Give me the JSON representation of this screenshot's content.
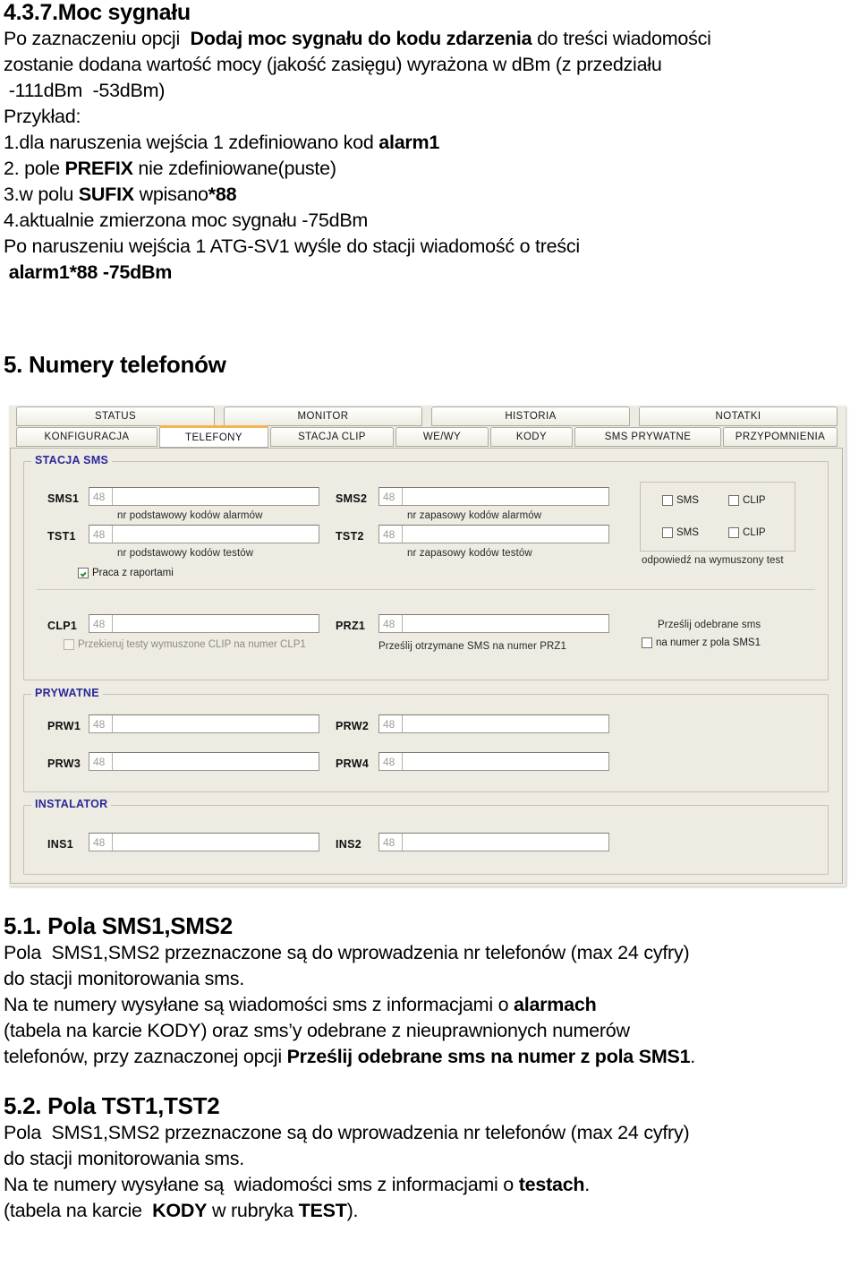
{
  "doc": {
    "section_4_3_7": {
      "heading": "4.3.7.Moc sygnału",
      "line1_a": "Po zaznaczeniu opcji  ",
      "line1_b": "Dodaj moc sygnału do kodu zdarzenia",
      "line1_c": " do treści wiadomości",
      "line2": "zostanie dodana wartość mocy (jakość zasięgu) wyrażona w dBm (z przedziału",
      "line3": " -111dBm  -53dBm)",
      "line4": "Przykład:",
      "line5_a": "1.dla naruszenia wejścia 1 zdefiniowano kod ",
      "line5_b": "alarm1",
      "line6_a": "2. pole ",
      "line6_b": "PREFIX",
      "line6_c": " nie zdefiniowane(puste)",
      "line7_a": "3.w polu ",
      "line7_b": "SUFIX",
      "line7_c": " wpisano",
      "line7_d": "*88",
      "line8": "4.aktualnie zmierzona moc sygnału -75dBm",
      "line9": "Po naruszeniu wejścia 1 ATG-SV1 wyśle do stacji wiadomość o treści",
      "line10": " alarm1*88 -75dBm"
    },
    "section_5": {
      "heading": "5. Numery telefonów"
    },
    "section_5_1": {
      "heading": "5.1. Pola SMS1,SMS2",
      "line1": "Pola  SMS1,SMS2 przeznaczone są do wprowadzenia nr telefonów (max 24 cyfry)",
      "line2": "do stacji monitorowania sms.",
      "line3_a": "Na te numery wysyłane są wiadomości sms z informacjami o ",
      "line3_b": "alarmach",
      "line4": "(tabela na karcie KODY) oraz sms’y odebrane z nieuprawnionych numerów",
      "line5_a": "telefonów, przy zaznaczonej opcji ",
      "line5_b": "Prześlij odebrane sms na numer z pola SMS1",
      "line5_c": "."
    },
    "section_5_2": {
      "heading": "5.2. Pola TST1,TST2",
      "line1": "Pola  SMS1,SMS2 przeznaczone są do wprowadzenia nr telefonów (max 24 cyfry)",
      "line2": "do stacji monitorowania sms.",
      "line3_a": "Na te numery wysyłane są  wiadomości sms z informacjami o ",
      "line3_b": "testach",
      "line3_c": ".",
      "line4_a": "(tabela na karcie  ",
      "line4_b": "KODY",
      "line4_c": " w rubryka ",
      "line4_d": "TEST",
      "line4_e": ")."
    }
  },
  "app": {
    "colors": {
      "panel_bg": "#ece9e0",
      "selected_tab_accent": "#f0b450",
      "group_title": "#2a2a99",
      "check_mark": "#2e8b3a"
    },
    "tabs_row1": [
      {
        "label": "STATUS",
        "selected": false
      },
      {
        "label": "MONITOR",
        "selected": false
      },
      {
        "label": "HISTORIA",
        "selected": false
      },
      {
        "label": "NOTATKI",
        "selected": false
      }
    ],
    "tabs_row2": [
      {
        "label": "KONFIGURACJA",
        "selected": false
      },
      {
        "label": "TELEFONY",
        "selected": true
      },
      {
        "label": "STACJA CLIP",
        "selected": false
      },
      {
        "label": "WE/WY",
        "selected": false
      },
      {
        "label": "KODY",
        "selected": false
      },
      {
        "label": "SMS PRYWATNE",
        "selected": false
      },
      {
        "label": "PRZYPOMNIENIA",
        "selected": false
      }
    ],
    "groups": {
      "stacja_sms": {
        "title": "STACJA SMS",
        "fields": [
          {
            "label": "SMS1",
            "prefix": "48",
            "value": "",
            "hint": "nr podstawowy kodów alarmów"
          },
          {
            "label": "SMS2",
            "prefix": "48",
            "value": "",
            "hint": "nr zapasowy kodów alarmów"
          },
          {
            "label": "TST1",
            "prefix": "48",
            "value": "",
            "hint": "nr podstawowy kodów testów"
          },
          {
            "label": "TST2",
            "prefix": "48",
            "value": "",
            "hint": "nr zapasowy kodów testów"
          },
          {
            "label": "CLP1",
            "prefix": "48",
            "value": "",
            "hint": "Przekieruj testy wymuszone CLIP  na numer CLP1"
          },
          {
            "label": "PRZ1",
            "prefix": "48",
            "value": "",
            "hint": "Prześlij otrzymane SMS na numer PRZ1"
          }
        ],
        "praca_z_raportami": {
          "label": "Praca z raportami",
          "checked": true
        },
        "answer_group": {
          "checkboxes": [
            {
              "label": "SMS",
              "checked": false
            },
            {
              "label": "CLIP",
              "checked": false
            },
            {
              "label": "SMS",
              "checked": false
            },
            {
              "label": "CLIP",
              "checked": false
            }
          ],
          "caption": "odpowiedź na  wymuszony test"
        },
        "clp1_checkbox": {
          "label": "Przekieruj testy wymuszone CLIP  na numer CLP1",
          "checked": false,
          "disabled": true
        },
        "forward_sms": {
          "caption": "Prześlij odebrane sms",
          "label": "na numer z pola SMS1",
          "checked": false
        }
      },
      "prywatne": {
        "title": "PRYWATNE",
        "fields": [
          {
            "label": "PRW1",
            "prefix": "48",
            "value": ""
          },
          {
            "label": "PRW2",
            "prefix": "48",
            "value": ""
          },
          {
            "label": "PRW3",
            "prefix": "48",
            "value": ""
          },
          {
            "label": "PRW4",
            "prefix": "48",
            "value": ""
          }
        ]
      },
      "instalator": {
        "title": "INSTALATOR",
        "fields": [
          {
            "label": "INS1",
            "prefix": "48",
            "value": ""
          },
          {
            "label": "INS2",
            "prefix": "48",
            "value": ""
          }
        ]
      }
    }
  }
}
